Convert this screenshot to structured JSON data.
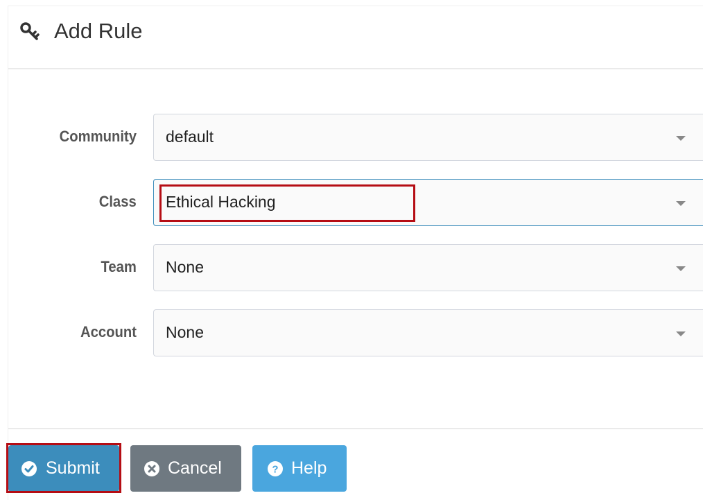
{
  "header": {
    "icon": "key-icon",
    "title": "Add Rule"
  },
  "form": {
    "community": {
      "label": "Community",
      "value": "default",
      "icon": "chevron-down-icon"
    },
    "class": {
      "label": "Class",
      "value": "Ethical Hacking",
      "icon": "chevron-down-icon"
    },
    "team": {
      "label": "Team",
      "value": "None",
      "icon": "chevron-down-icon"
    },
    "account": {
      "label": "Account",
      "value": "None",
      "icon": "chevron-down-icon"
    }
  },
  "actions": {
    "submit": {
      "label": "Submit",
      "icon": "check-circle-icon",
      "color": "#3c8dbc"
    },
    "cancel": {
      "label": "Cancel",
      "icon": "times-circle-icon",
      "color": "#6f7981"
    },
    "help": {
      "label": "Help",
      "icon": "question-circle-icon",
      "color": "#4aa6de"
    }
  },
  "colors": {
    "highlight": "#b50d14",
    "focus_border": "#3c8dbc"
  }
}
